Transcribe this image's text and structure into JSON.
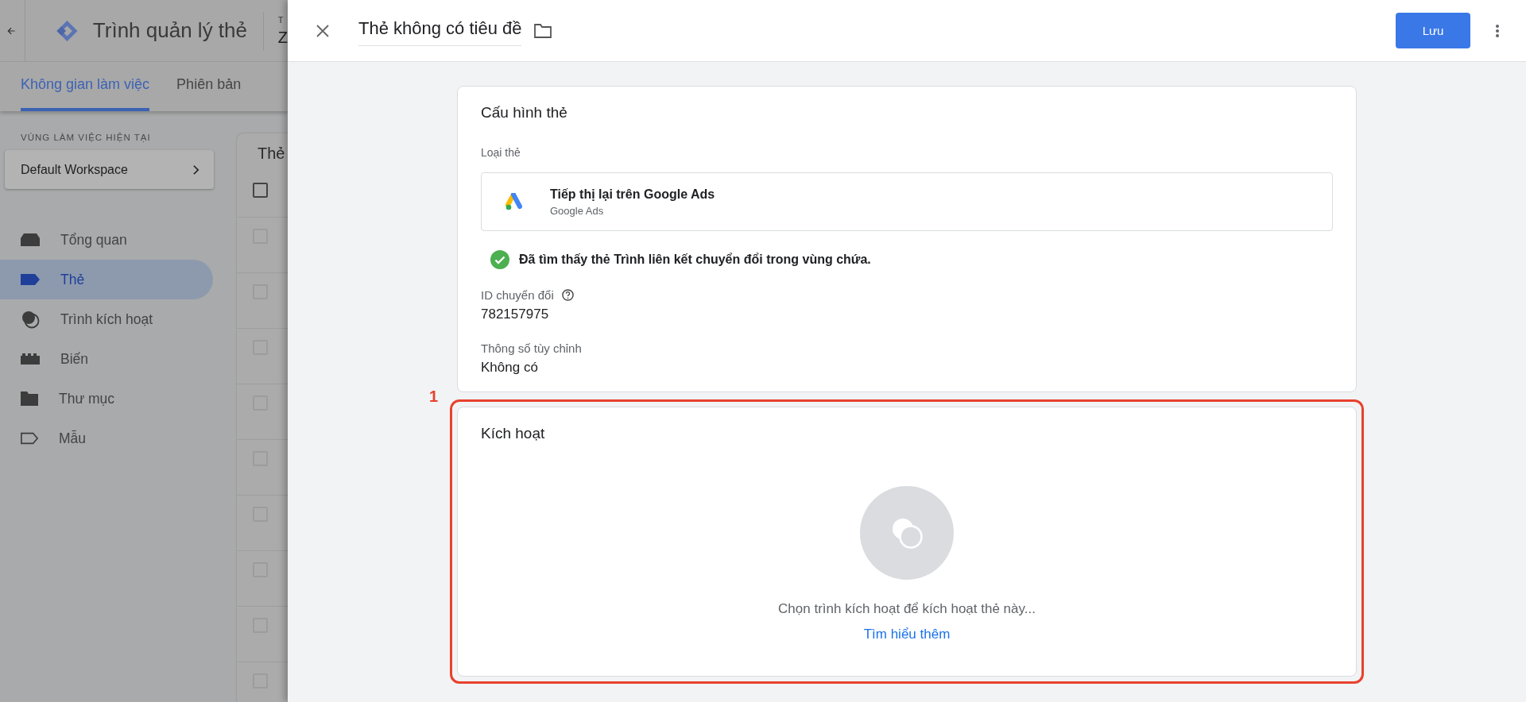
{
  "app": {
    "title": "Trình quản lý thẻ",
    "account_label": "T",
    "container_name": "Z"
  },
  "tabs": [
    {
      "label": "Không gian làm việc",
      "selected": true
    },
    {
      "label": "Phiên bản",
      "selected": false
    }
  ],
  "workspace": {
    "heading": "VÙNG LÀM VIỆC HIỆN TẠI",
    "name": "Default Workspace"
  },
  "nav": [
    {
      "label": "Tổng quan",
      "kind": "overview",
      "selected": false
    },
    {
      "label": "Thẻ",
      "kind": "tags",
      "selected": true
    },
    {
      "label": "Trình kích hoạt",
      "kind": "triggers",
      "selected": false
    },
    {
      "label": "Biến",
      "kind": "variables",
      "selected": false
    },
    {
      "label": "Thư mục",
      "kind": "folders",
      "selected": false
    },
    {
      "label": "Mẫu",
      "kind": "templates",
      "selected": false
    }
  ],
  "tag_list": {
    "heading": "Thẻ",
    "select_all_checked": false,
    "rows": [
      {
        "checked": false
      },
      {
        "checked": false
      },
      {
        "checked": false
      },
      {
        "checked": false
      },
      {
        "checked": false
      },
      {
        "checked": false
      },
      {
        "checked": false
      },
      {
        "checked": false
      },
      {
        "checked": false
      }
    ]
  },
  "editor": {
    "title": "Thẻ không có tiêu đề",
    "save_label": "Lưu",
    "config": {
      "heading": "Cấu hình thẻ",
      "type_label": "Loại thẻ",
      "type_name": "Tiếp thị lại trên Google Ads",
      "type_vendor": "Google Ads",
      "notice": "Đã tìm thấy thẻ Trình liên kết chuyển đổi trong vùng chứa.",
      "fields": [
        {
          "label": "ID chuyển đổi",
          "help": true,
          "value": "782157975"
        },
        {
          "label": "Thông số tùy chỉnh",
          "help": false,
          "value": "Không có"
        }
      ]
    },
    "triggering": {
      "heading": "Kích hoạt",
      "hint": "Chọn trình kích hoạt để kích hoạt thẻ này...",
      "link": "Tìm hiểu thêm",
      "annotation": "1"
    }
  }
}
